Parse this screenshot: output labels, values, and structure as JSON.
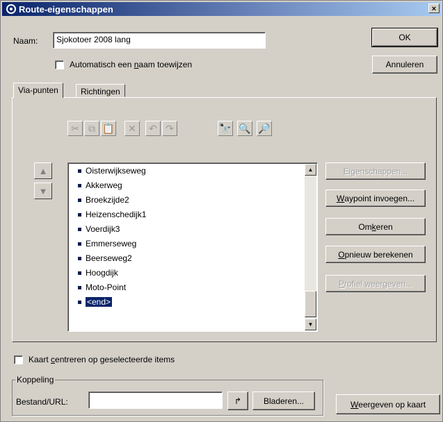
{
  "window": {
    "title": "Route-eigenschappen",
    "close": "×"
  },
  "name_row": {
    "label": "Naam:",
    "value": "Sjokotoer 2008 lang"
  },
  "auto_name": {
    "label_pre": "Automatisch een ",
    "label_u": "n",
    "label_post": "aam toewijzen",
    "checked": false
  },
  "buttons": {
    "ok": "OK",
    "cancel": "Annuleren"
  },
  "tabs": [
    {
      "label": "Via-punten",
      "active": true
    },
    {
      "label": "Richtingen",
      "active": false
    }
  ],
  "toolbar": [
    {
      "icon": "cut-icon",
      "glyph": "✂",
      "enabled": false
    },
    {
      "icon": "copy-icon",
      "glyph": "⧉",
      "enabled": false
    },
    {
      "icon": "paste-icon",
      "glyph": "📋",
      "enabled": false
    },
    {
      "icon": "delete-icon",
      "glyph": "✕",
      "enabled": false
    },
    {
      "icon": "undo-icon",
      "glyph": "↶",
      "enabled": false
    },
    {
      "icon": "redo-icon",
      "glyph": "↷",
      "enabled": false
    },
    {
      "icon": "find-icon",
      "glyph": "🔭",
      "enabled": true
    },
    {
      "icon": "find-next-icon",
      "glyph": "🔍",
      "enabled": true
    },
    {
      "icon": "find-prev-icon",
      "glyph": "🔎",
      "enabled": true
    }
  ],
  "waypoints": [
    "Oisterwijkseweg",
    "Akkerweg",
    "Broekzijde2",
    "Heizenschedijk1",
    "Voerdijk3",
    "Emmerseweg",
    "Beerseweg2",
    "Hoogdijk",
    "Moto-Point",
    "<end>"
  ],
  "side_buttons": [
    {
      "pre": "Eigenschappen...",
      "u": "",
      "post": "",
      "enabled": false
    },
    {
      "pre": "",
      "u": "W",
      "post": "aypoint invoegen...",
      "enabled": true
    },
    {
      "pre": "Om",
      "u": "k",
      "post": "eren",
      "enabled": true
    },
    {
      "pre": "",
      "u": "O",
      "post": "pnieuw berekenen",
      "enabled": true
    },
    {
      "pre": "",
      "u": "P",
      "post": "rofiel weergeven...",
      "enabled": false
    }
  ],
  "center_map": {
    "pre": "Kaart ",
    "u": "c",
    "post": "entreren op geselecteerde items",
    "checked": false
  },
  "link_group": {
    "legend": "Koppeling",
    "label": "Bestand/URL:",
    "value": "",
    "browse": "Bladeren..."
  },
  "show_on_map": {
    "pre": "",
    "u": "W",
    "post": "eergeven op kaart"
  }
}
